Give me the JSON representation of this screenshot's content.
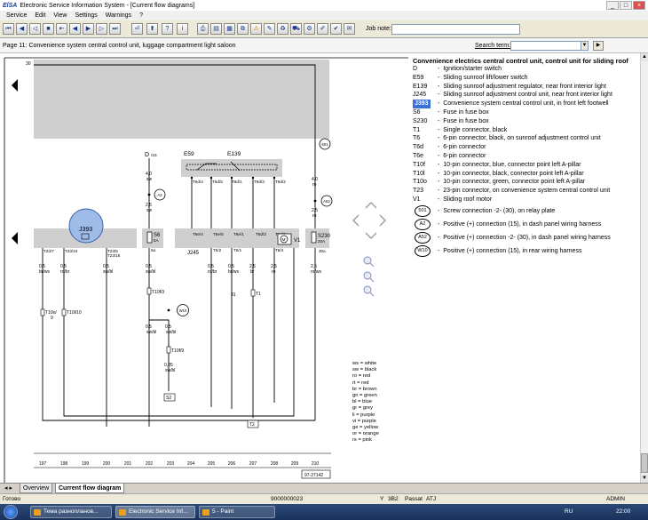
{
  "window": {
    "title": "Electronic Service Information System - [Current flow diagrams]",
    "logo": "ElSA"
  },
  "menu": [
    "Service",
    "Edit",
    "View",
    "Settings",
    "Warnings",
    "?"
  ],
  "toolbar": {
    "job_note_label": "Job note:",
    "job_note_value": ""
  },
  "page_header": {
    "title": "Page 11: Convenience system central control unit, luggage compartment light saloon",
    "search_label": "Search term:",
    "search_value": ""
  },
  "legend": {
    "heading": "Convenience electrics central control unit, control unit for sliding roof",
    "items": [
      {
        "code": "D",
        "desc": "Ignition/starter switch"
      },
      {
        "code": "E59",
        "desc": "Sliding sunroof lift/lower switch"
      },
      {
        "code": "E139",
        "desc": "Sliding sunroof adjustment regulator, near front interior light"
      },
      {
        "code": "J245",
        "desc": "Sliding sunroof adjustment control unit, near front interior light"
      },
      {
        "code": "J393",
        "desc": "Convenience system central control unit, in front left footwell",
        "highlight": true
      },
      {
        "code": "S6",
        "desc": "Fuse in fuse box"
      },
      {
        "code": "S230",
        "desc": "Fuse in fuse box"
      },
      {
        "code": "T1",
        "desc": "Single connector, black"
      },
      {
        "code": "T6",
        "desc": "6-pin connector, black, on sunroof adjustment control unit"
      },
      {
        "code": "T6d",
        "desc": "6-pin connector"
      },
      {
        "code": "T6e",
        "desc": "6-pin connector"
      },
      {
        "code": "T10f",
        "desc": "10-pin connector, blue, connector point left A-pillar"
      },
      {
        "code": "T10l",
        "desc": "10-pin connector, black, connector point left A-pillar"
      },
      {
        "code": "T10o",
        "desc": "10-pin connector, green, connector point left A-pillar"
      },
      {
        "code": "T23",
        "desc": "23-pin connector, on convenience system central control unit"
      },
      {
        "code": "V1",
        "desc": "Sliding roof motor"
      }
    ],
    "circle_items": [
      {
        "code": "501",
        "desc": "Screw connection -2- (30), on relay plate"
      },
      {
        "code": "A2",
        "desc": "Positive (+) connection (15), in dash panel wiring harness"
      },
      {
        "code": "A52",
        "desc": "Positive (+) connection -2- (30), in dash panel wiring harness"
      },
      {
        "code": "W10",
        "desc": "Positive (+) connection (15), in rear wiring harness"
      }
    ]
  },
  "color_key": [
    "ws = white",
    "sw = black",
    "ro = red",
    "rt = red",
    "br = brown",
    "gn = green",
    "bl = blue",
    "gr = grey",
    "li = purple",
    "vi = purple",
    "ge = yellow",
    "or = orange",
    "rs = pink"
  ],
  "diagram": {
    "rail_label": "30",
    "components": {
      "D": "D",
      "D_term": "/15",
      "E59": "E59",
      "E139": "E139",
      "J393": "J393",
      "J245": "J245",
      "S6": "S6",
      "S6_rating": "5A",
      "S230": "S230",
      "S230_rating": "20A",
      "V1": "V1",
      "M": "M"
    },
    "pins": {
      "T23_7": "T23/7",
      "T23_10": "T23/10",
      "T23_5": "T23/5",
      "T23_16": "T23/16",
      "t6a": "6a",
      "T6e_4": "T6e/4",
      "T6e_5": "T6e/5",
      "T6e_1": "T6e/1",
      "T6_2": "T6/2",
      "T6_1": "T6/1",
      "T6_4": "T6/4",
      "t30a": "30a",
      "T6d_4": "T6d/4",
      "T6d_5": "T6d/5",
      "T6d_1": "T6d/1",
      "T6d_3": "T6d/3",
      "T6d_2": "T6d/2",
      "T10f_3": "T10f/3",
      "T10f_9": "T10f/9",
      "T10o_9": "T10o/",
      "T10o_9b": "9",
      "T10l_10": "T10l/10",
      "T1": "T1",
      "T1_31": "31"
    },
    "wires": [
      {
        "id": "w197",
        "size": "0,5",
        "color": "br/ws"
      },
      {
        "id": "w198",
        "size": "0,5",
        "color": "ro/br"
      },
      {
        "id": "w200",
        "size": "0,5",
        "color": "sw/bl"
      },
      {
        "id": "w202",
        "size": "0,5",
        "color": "sw/bl"
      },
      {
        "id": "w204",
        "size": "0,5",
        "color": "ro/br"
      },
      {
        "id": "w205",
        "size": "0,5",
        "color": "ro/br"
      },
      {
        "id": "w206",
        "size": "0,5",
        "color": "br/ws"
      },
      {
        "id": "w207",
        "size": "2,5",
        "color": "br"
      },
      {
        "id": "w208",
        "size": "2,5",
        "color": "ro"
      },
      {
        "id": "w210",
        "size": "2,5",
        "color": "ro/ws"
      },
      {
        "id": "d_up",
        "size": "4,0",
        "color": "sw"
      },
      {
        "id": "d_mid",
        "size": "2,5",
        "color": "sw"
      },
      {
        "id": "d_202b",
        "size": "0,5",
        "color": "sw/bl"
      },
      {
        "id": "d_202c",
        "size": "0,5",
        "color": "sw/bl"
      },
      {
        "id": "d_202d",
        "size": "0,35",
        "color": "sw/bl"
      },
      {
        "id": "w210_up",
        "size": "4,0",
        "color": "ro"
      },
      {
        "id": "w210_mid",
        "size": "2,5",
        "color": "ro"
      }
    ],
    "circles": {
      "A2": "A2",
      "W10": "W10",
      "S501": "501",
      "A52": "A52"
    },
    "boxes": {
      "S2": "S2",
      "T2": "T2"
    },
    "columns": [
      "197",
      "198",
      "199",
      "200",
      "201",
      "202",
      "203",
      "204",
      "205",
      "206",
      "207",
      "208",
      "209",
      "210"
    ],
    "ref": "97-27142"
  },
  "tabs": [
    "Overview",
    "Current flow diagram"
  ],
  "status": {
    "left": "Готово",
    "doc_id": "9000000023",
    "y": "Y",
    "model": "3B2",
    "name": "Passat",
    "engine": "ATJ",
    "user": "ADMIN"
  },
  "taskbar": {
    "tasks": [
      "Тема разнопланов...",
      "Electronic Service Inf...",
      "5 - Paint"
    ],
    "lang": "RU",
    "clock": "22:00"
  }
}
